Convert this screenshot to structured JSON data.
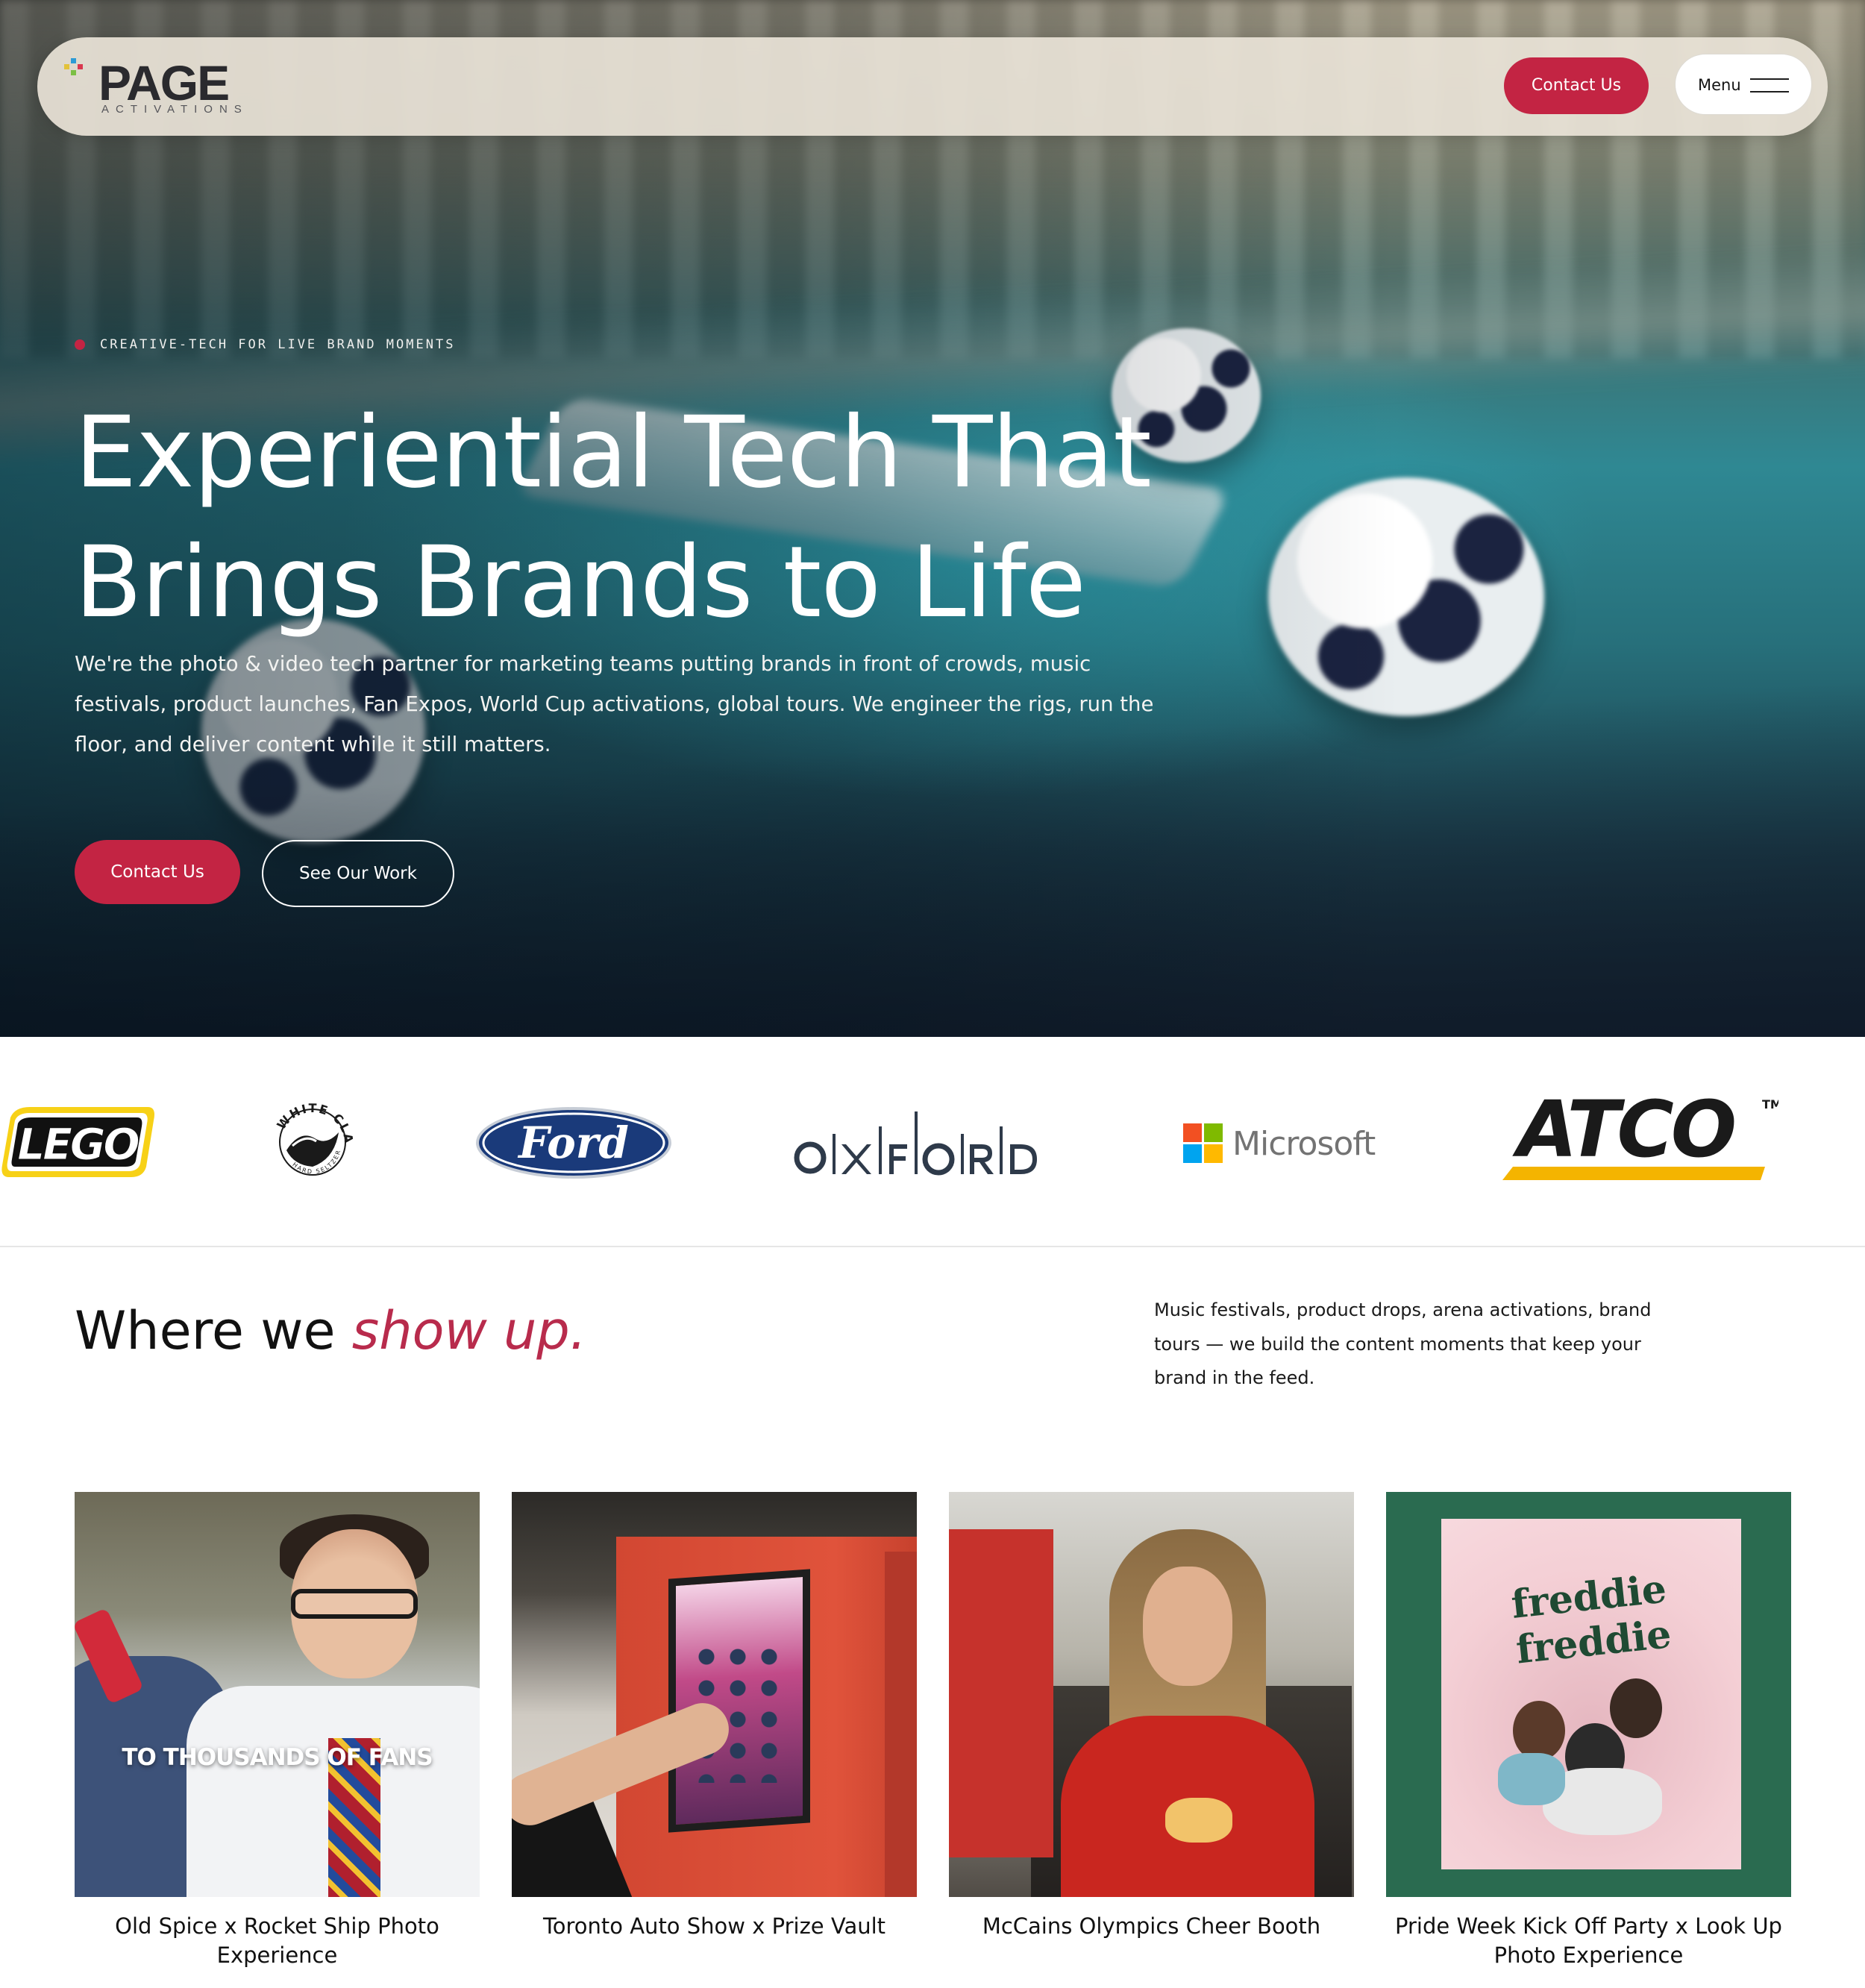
{
  "nav": {
    "logo_word": "PAGE",
    "logo_sub": "ACTIVATIONS",
    "contact_label": "Contact Us",
    "menu_label": "Menu"
  },
  "hero": {
    "eyebrow": "CREATIVE-TECH FOR LIVE BRAND MOMENTS",
    "title_line1": "Experiential Tech That",
    "title_line2": "Brings Brands to Life",
    "description": "We're the photo & video tech partner for marketing teams putting brands in front of crowds, music festivals, product launches, Fan Expos, World Cup activations, global tours. We engineer the rigs, run the floor, and deliver content while it still matters.",
    "contact_label": "Contact Us",
    "work_label": "See Our Work"
  },
  "clients": {
    "logos": [
      {
        "name": "LEGO",
        "icon": "lego-logo"
      },
      {
        "name": "WHITE CLAW HARD SELTZER",
        "icon": "white-claw-logo"
      },
      {
        "name": "Ford",
        "icon": "ford-logo"
      },
      {
        "name": "OXFORD",
        "icon": "oxford-logo"
      },
      {
        "name": "Microsoft",
        "icon": "microsoft-logo"
      },
      {
        "name": "ATCO",
        "icon": "atco-logo"
      }
    ]
  },
  "showup": {
    "title_plain": "Where we ",
    "title_accent": "show up.",
    "description": "Music festivals, product drops, arena activations, brand tours — we build the content moments that keep your brand in the feed."
  },
  "projects": [
    {
      "title": "Old Spice x Rocket Ship Photo Experience",
      "overlay": "TO THOUSANDS OF FANS"
    },
    {
      "title": "Toronto Auto Show x Prize Vault"
    },
    {
      "title": "McCains Olympics Cheer Booth"
    },
    {
      "title": "Pride Week Kick Off Party x Look Up Photo Experience",
      "overlay": "freddie freddie"
    }
  ],
  "colors": {
    "accent": "#c32443",
    "accent_italic": "#b82b4c",
    "nav_bg": "#e8e2d6",
    "pride_green": "#2a6b50"
  }
}
